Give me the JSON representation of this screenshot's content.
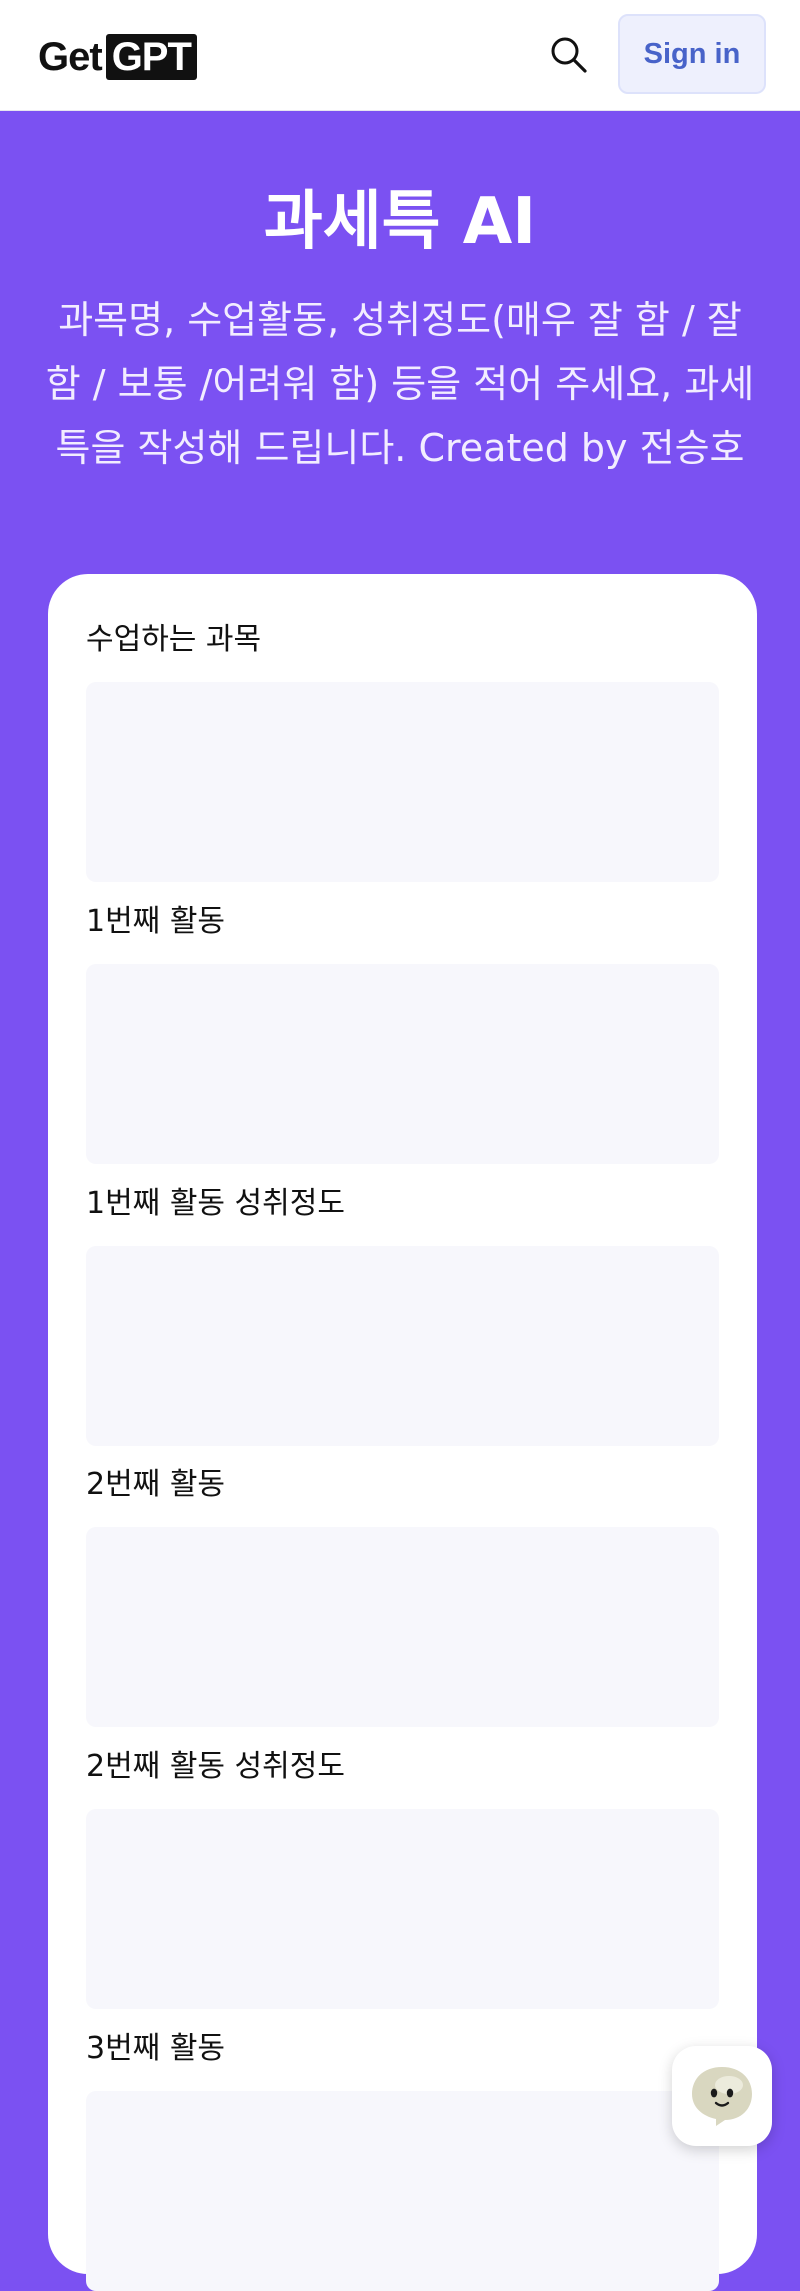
{
  "header": {
    "logo_get": "Get",
    "logo_gpt": "GPT",
    "search_icon": "search-icon",
    "signin_label": "Sign in"
  },
  "hero": {
    "title": "과세특 AI",
    "subtitle": "과목명, 수업활동, 성취정도(매우 잘 함 / 잘 함 / 보통 /어려워 함) 등을 적어 주세요, 과세특을 작성해 드립니다. Created by 전승호"
  },
  "form": {
    "fields": [
      {
        "label": "수업하는 과목",
        "value": ""
      },
      {
        "label": "1번째 활동",
        "value": ""
      },
      {
        "label": "1번째 활동 성취정도",
        "value": ""
      },
      {
        "label": "2번째 활동",
        "value": ""
      },
      {
        "label": "2번째 활동 성취정도",
        "value": ""
      },
      {
        "label": "3번째 활동",
        "value": ""
      }
    ]
  },
  "chat_widget": {
    "icon": "chat-bot-icon"
  },
  "colors": {
    "brand_purple": "#7b51f2",
    "signin_text": "#4863c9",
    "signin_bg": "#eef0fd",
    "input_bg": "#f7f7fc"
  }
}
